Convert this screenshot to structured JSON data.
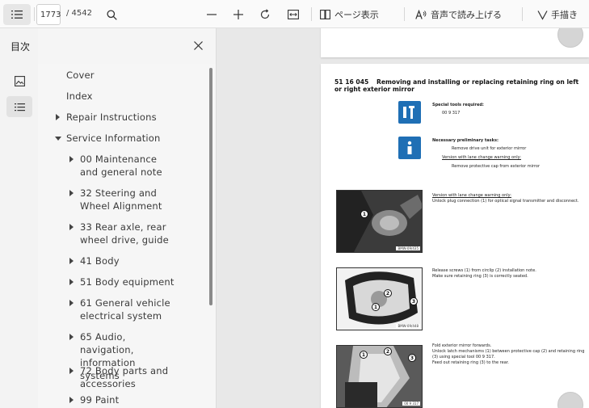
{
  "toolbar": {
    "current_page": "1773",
    "total_pages": "/ 4542",
    "page_view_label": "ページ表示",
    "read_aloud_label": "音声で読み上げる",
    "draw_label": "手描き"
  },
  "toc": {
    "title": "目次",
    "items": [
      {
        "label": "Cover",
        "level": 0,
        "arrow": "none"
      },
      {
        "label": "Index",
        "level": 0,
        "arrow": "none"
      },
      {
        "label": "Repair Instructions",
        "level": 0,
        "arrow": "right"
      },
      {
        "label": "Service Information",
        "level": 0,
        "arrow": "down"
      },
      {
        "label": "00 Maintenance and general note",
        "level": 1,
        "arrow": "right"
      },
      {
        "label": "32 Steering and Wheel Alignment",
        "level": 1,
        "arrow": "right"
      },
      {
        "label": "33 Rear axle, rear wheel drive, guide",
        "level": 1,
        "arrow": "right"
      },
      {
        "label": "41 Body",
        "level": 1,
        "arrow": "right"
      },
      {
        "label": "51 Body equipment",
        "level": 1,
        "arrow": "right"
      },
      {
        "label": "61 General vehicle electrical system",
        "level": 1,
        "arrow": "right"
      },
      {
        "label": "65 Audio, navigation, information systems",
        "level": 1,
        "arrow": "right"
      },
      {
        "label": "72 Body parts and accessories",
        "level": 1,
        "arrow": "right"
      },
      {
        "label": "99 Paint",
        "level": 1,
        "arrow": "right"
      }
    ]
  },
  "document": {
    "section_number": "51 16 045",
    "heading": "Removing and installing or replacing retaining ring on left or right exterior mirror",
    "special_tools_label": "Special tools required:",
    "special_tool_item": "00 9 317",
    "preliminary_label": "Necessary preliminary tasks:",
    "preliminary_item_1": "Remove drive unit for exterior mirror",
    "preliminary_version": "Version with lane change warning only:",
    "preliminary_item_2": "Remove protective cap from exterior mirror",
    "step1_title": "Version with lane change warning only:",
    "step1_text": "Unlock plug connection (1) for optical signal transmitter and disconnect.",
    "step2_line1": "Release screws (1) from circlip (2) installation note.",
    "step2_line2": "Make sure retaining ring (3) is correctly seated.",
    "step3_line1": "Fold exterior mirror forwards.",
    "step3_line2": "Unlock latch mechanisms (1) between protective cap (2) and retaining ring (3) using special tool 00 9 317.",
    "step3_line3": "Feed out retaining ring (3) to the rear.",
    "photo1_tag": "BMW-09/435",
    "photo2_tag": "BMW-09/448",
    "photo3_tag": "00 9 317"
  },
  "colors": {
    "accent_icon_blue": "#1f6fb5",
    "toolbar_bg": "#fafafa",
    "panel_bg": "#f6f6f6"
  }
}
